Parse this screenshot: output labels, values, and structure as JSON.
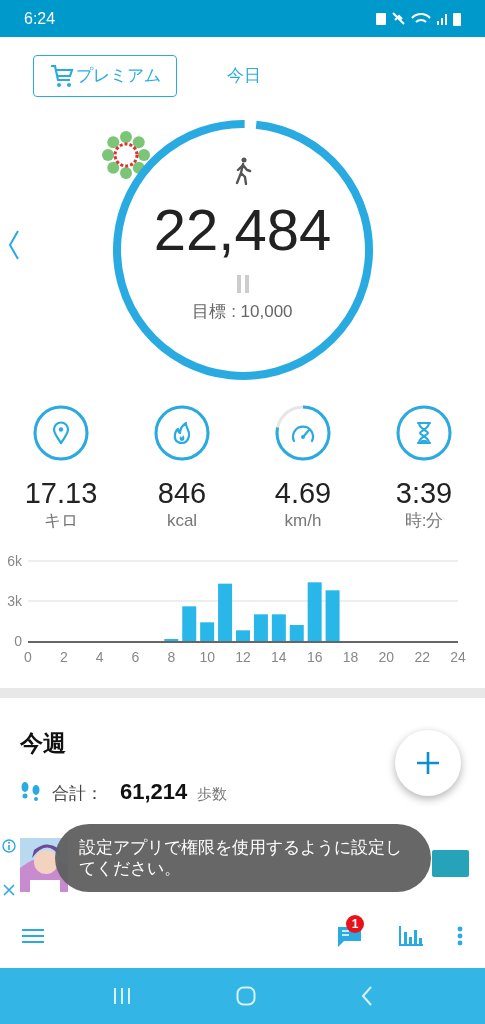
{
  "status_bar": {
    "time": "6:24"
  },
  "header": {
    "premium_button": "プレミアム",
    "tab": "今日"
  },
  "ring": {
    "steps": "22,484",
    "goal": "目標 : 10,000"
  },
  "stats": [
    {
      "kind": "distance",
      "value": "17.13",
      "unit": "キロ"
    },
    {
      "kind": "calories",
      "value": "846",
      "unit": "kcal"
    },
    {
      "kind": "speed",
      "value": "4.69",
      "unit": "km/h"
    },
    {
      "kind": "time",
      "value": "3:39",
      "unit": "時:分"
    }
  ],
  "chart_data": {
    "type": "bar",
    "x": [
      8,
      9,
      10,
      11,
      12,
      13,
      14,
      15,
      16,
      17
    ],
    "series": [
      {
        "color": "#29b6e8",
        "values": [
          150,
          2600,
          1400,
          4300,
          800,
          2000,
          2000,
          1200,
          4400,
          3800
        ]
      }
    ],
    "xlim": [
      0,
      24
    ],
    "ylim": [
      0,
      6000
    ],
    "xticks": [
      0,
      2,
      4,
      6,
      8,
      10,
      12,
      14,
      16,
      18,
      20,
      22,
      24
    ],
    "yticks": [
      {
        "value": 0,
        "label": "0"
      },
      {
        "value": 3000,
        "label": "3k"
      },
      {
        "value": 6000,
        "label": "6k"
      }
    ]
  },
  "week": {
    "title": "今週",
    "rows": [
      {
        "label": "合計：",
        "value": "61,214",
        "unit": "歩数"
      }
    ]
  },
  "toast": "設定アプリで権限を使用するように設定してください。",
  "toolbar": {
    "badge": "1"
  }
}
